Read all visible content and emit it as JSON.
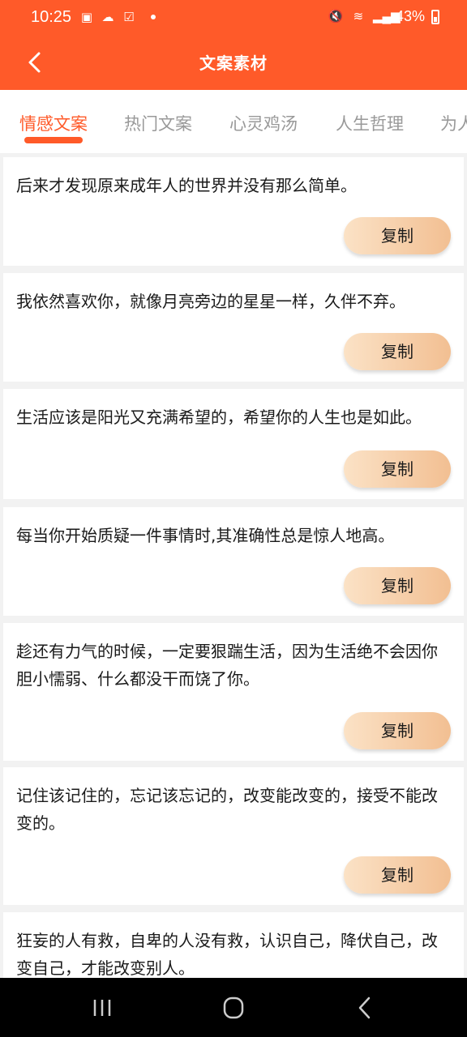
{
  "status": {
    "time": "10:25",
    "battery": "43%",
    "left_icons": [
      "gallery-icon",
      "cloud-icon",
      "check-icon"
    ],
    "right_icons": [
      "mute-icon",
      "wifi-icon",
      "signal-icon"
    ]
  },
  "header": {
    "title": "文案素材"
  },
  "tabs": [
    {
      "label": "情感文案",
      "active": true
    },
    {
      "label": "热门文案"
    },
    {
      "label": "心灵鸡汤"
    },
    {
      "label": "人生哲理"
    },
    {
      "label": "为人"
    }
  ],
  "copy_label": "复制",
  "items": [
    {
      "text": "后来才发现原来成年人的世界并没有那么简单。"
    },
    {
      "text": "我依然喜欢你，就像月亮旁边的星星一样，久伴不弃。"
    },
    {
      "text": "生活应该是阳光又充满希望的，希望你的人生也是如此。"
    },
    {
      "text": "每当你开始质疑一件事情时,其准确性总是惊人地高。"
    },
    {
      "text": "趁还有力气的时候，一定要狠踹生活，因为生活绝不会因你胆小懦弱、什么都没干而饶了你。"
    },
    {
      "text": "记住该记住的，忘记该忘记的，改变能改变的，接受不能改变的。"
    },
    {
      "text": "狂妄的人有救，自卑的人没有救，认识自己，降伏自己，改变自己，才能改变别人。"
    }
  ],
  "colors": {
    "accent": "#ff5a29",
    "button_from": "#fbe2c6",
    "button_to": "#f2bf92"
  }
}
